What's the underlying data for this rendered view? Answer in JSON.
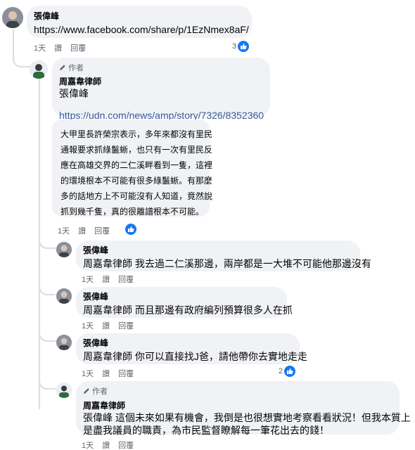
{
  "comments": [
    {
      "author": "張偉峰",
      "link": "https://www.facebook.com/share/p/1EzNmex8aF/",
      "time": "1天",
      "like_label": "讚",
      "reply_label": "回覆",
      "reaction_count": "3"
    },
    {
      "author_tag": "作者",
      "author": "周嘉韋律師",
      "mention": "張偉峰",
      "link": "https://udn.com/news/amp/story/7326/8352360",
      "quote_lines": [
        "大甲里長許榮宗表示，多年來都沒有里民",
        "通報要求抓綠鬣蜥，也只有一次有里民反",
        "應在高雄交界的二仁溪畔看到一隻，這裡",
        "的環境根本不可能有很多綠鬣蜥。有那麼",
        "多的話地方上不可能沒有人知道，竟然說",
        "抓到幾千隻，真的很離譜根本不可能。"
      ],
      "time": "1天",
      "like_label": "讚",
      "reply_label": "回覆"
    },
    {
      "author": "張偉峰",
      "text": "周嘉韋律師 我去過二仁溪那邊，兩岸都是一大堆不可能他那邊沒有",
      "time": "1天",
      "like_label": "讚",
      "reply_label": "回覆"
    },
    {
      "author": "張偉峰",
      "text": "周嘉韋律師 而且那邊有政府編列預算很多人在抓",
      "time": "1天",
      "like_label": "讚",
      "reply_label": "回覆"
    },
    {
      "author": "張偉峰",
      "text": "周嘉韋律師 你可以直接找J爸，請他帶你去實地走走",
      "time": "1天",
      "like_label": "讚",
      "reply_label": "回覆",
      "reaction_count": "2"
    },
    {
      "author_tag": "作者",
      "author": "周嘉韋律師",
      "text_line1": "張偉峰 這個未來如果有機會，我倒是也很想實地考察看看狀況！但我本質上",
      "text_line2": "是盡我議員的職責，為市民監督瞭解每一筆花出去的錢！",
      "time": "1天",
      "like_label": "讚",
      "reply_label": "回覆"
    }
  ],
  "colors": {
    "bubble": "#f0f2f5",
    "link": "#385898",
    "like_blue": "#1877f2",
    "meta": "#65676b"
  }
}
